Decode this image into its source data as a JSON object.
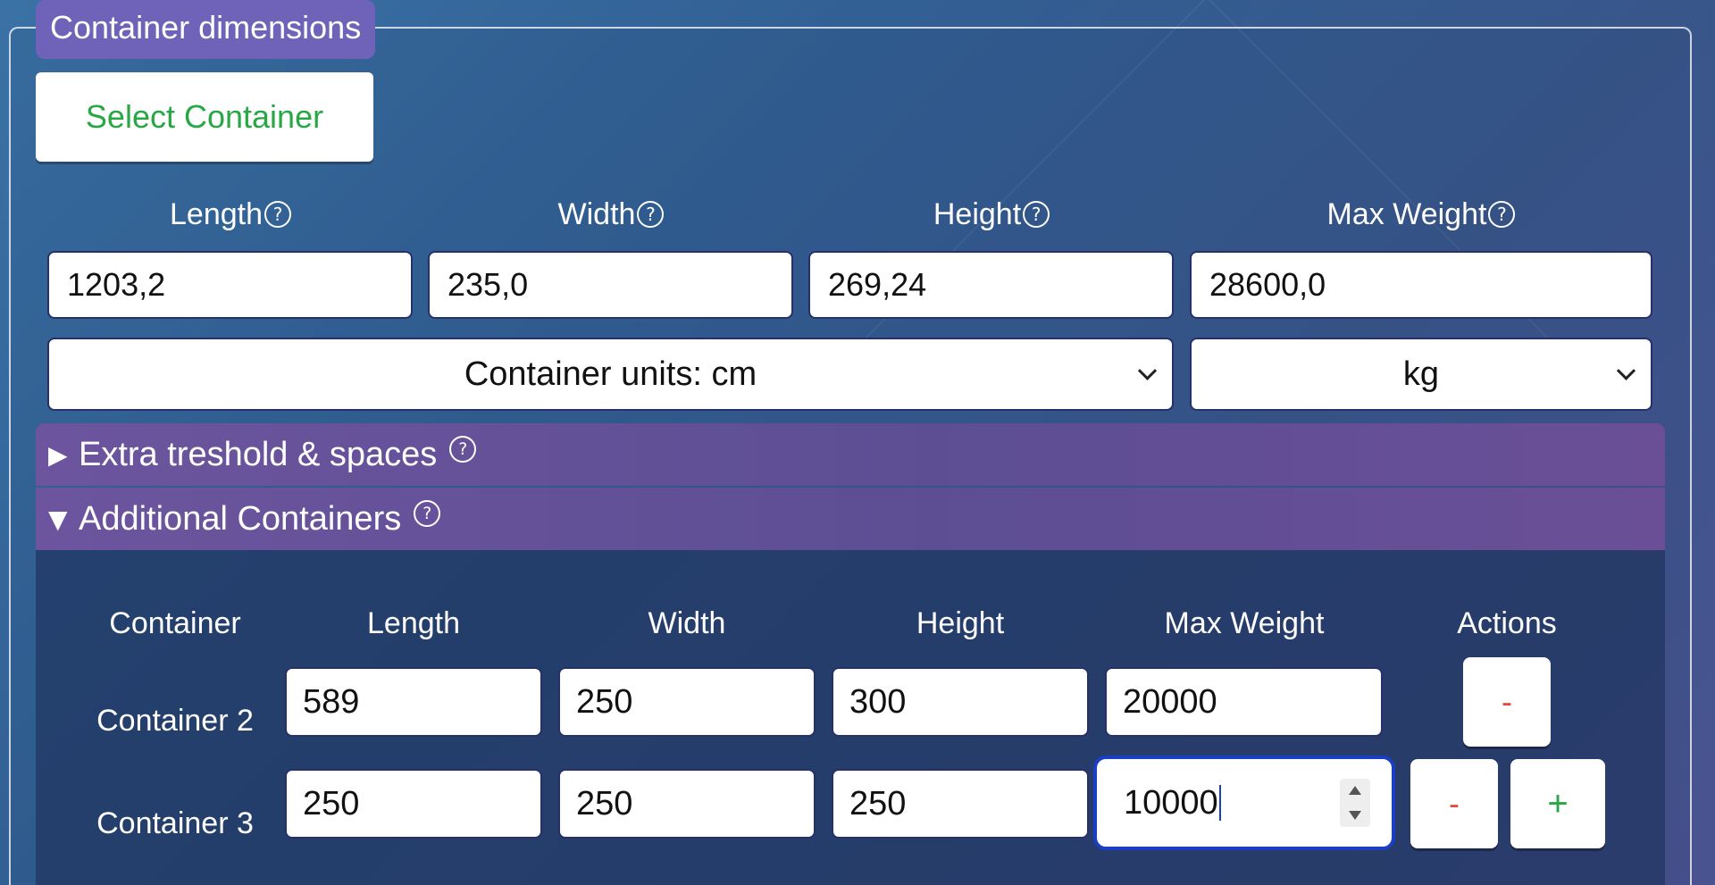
{
  "section": {
    "legend": "Container dimensions",
    "select_container_label": "Select Container"
  },
  "dimensions": {
    "labels": {
      "length": "Length",
      "width": "Width",
      "height": "Height",
      "max_weight": "Max Weight"
    },
    "help_glyph": "?",
    "values": {
      "length": "1203,2",
      "width": "235,0",
      "height": "269,24",
      "max_weight": "28600,0"
    },
    "units_select": "Container units: cm",
    "weight_unit_select": "kg"
  },
  "accordions": {
    "extra": {
      "arrow": "▶",
      "title": "Extra treshold & spaces"
    },
    "additional": {
      "arrow": "▼",
      "title": "Additional Containers"
    }
  },
  "additional_table": {
    "headers": [
      "Container",
      "Length",
      "Width",
      "Height",
      "Max Weight",
      "Actions"
    ],
    "rows": [
      {
        "label": "Container 2",
        "length": "589",
        "width": "250",
        "height": "300",
        "max_weight": "20000"
      },
      {
        "label": "Container 3",
        "length": "250",
        "width": "250",
        "height": "250",
        "max_weight": "10000"
      }
    ],
    "remove_label": "-",
    "add_label": "+"
  },
  "colors": {
    "accent_green": "#28a745",
    "remove_red": "#e34b3c",
    "legend_purple": "#6e63b8",
    "focus_blue": "#1a3fc4"
  }
}
